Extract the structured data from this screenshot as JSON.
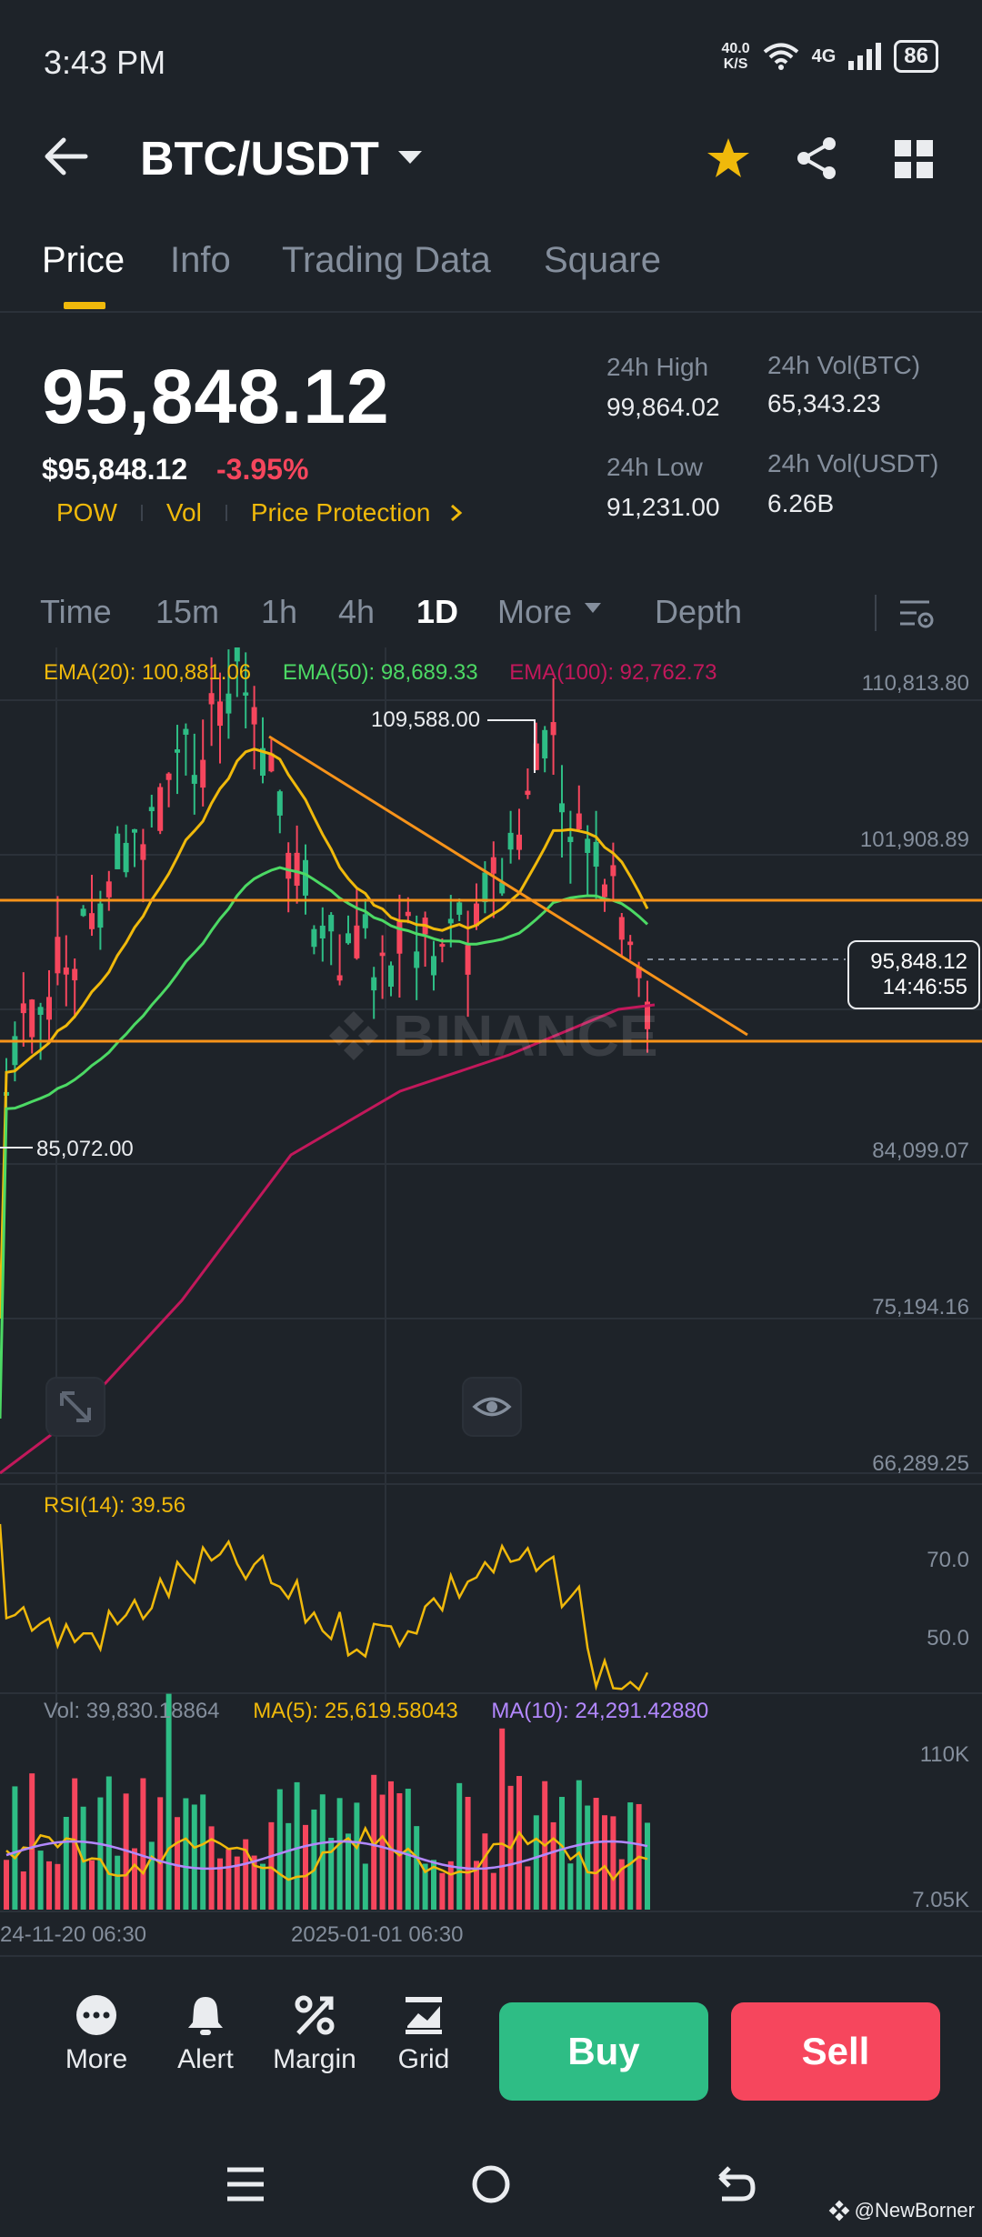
{
  "status": {
    "time": "3:43 PM",
    "net_speed_value": "40.0",
    "net_speed_unit": "K/S",
    "network": "4G",
    "battery": "86"
  },
  "header": {
    "pair": "BTC/USDT"
  },
  "tabs": [
    {
      "label": "Price"
    },
    {
      "label": "Info"
    },
    {
      "label": "Trading Data"
    },
    {
      "label": "Square"
    }
  ],
  "ticker": {
    "last_price": "95,848.12",
    "last_price_usd": "$95,848.12",
    "change_pct": "-3.95%",
    "tags": [
      "POW",
      "Vol",
      "Price Protection"
    ],
    "high_label": "24h High",
    "high_value": "99,864.02",
    "low_label": "24h Low",
    "low_value": "91,231.00",
    "vol_btc_label": "24h Vol(BTC)",
    "vol_btc_value": "65,343.23",
    "vol_usdt_label": "24h Vol(USDT)",
    "vol_usdt_value": "6.26B"
  },
  "timeframes": {
    "items": [
      "Time",
      "15m",
      "1h",
      "4h",
      "1D"
    ],
    "more": "More",
    "depth": "Depth",
    "active": "1D"
  },
  "chart": {
    "ema20": "EMA(20): 100,881.06",
    "ema50": "EMA(50): 98,689.33",
    "ema100": "EMA(100): 92,762.73",
    "price_axis": [
      "110,813.80",
      "101,908.89",
      "84,099.07",
      "75,194.16",
      "66,289.25"
    ],
    "high_marker": "109,588.00",
    "low_marker": "85,072.00",
    "current_price_tag": "95,848.12",
    "countdown": "14:46:55",
    "watermark": "BINANCE",
    "rsi_label": "RSI(14): 39.56",
    "rsi_axis": [
      "70.0",
      "50.0"
    ],
    "vol_label": "Vol: 39,830.18864",
    "ma5_label": "MA(5): 25,619.58043",
    "ma10_label": "MA(10): 24,291.42880",
    "vol_axis": [
      "110K",
      "7.05K"
    ],
    "date_labels": [
      "24-11-20 06:30",
      "2025-01-01 06:30"
    ]
  },
  "colors": {
    "bg": "#1e2329",
    "up": "#2ebd85",
    "down": "#f6465d",
    "ema20": "#f0b90b",
    "ema50": "#4cd964",
    "ema100": "#c2185b",
    "trend": "#f7931a"
  },
  "bottom_bar": {
    "items": [
      {
        "label": "More",
        "icon": "more-icon"
      },
      {
        "label": "Alert",
        "icon": "bell-icon"
      },
      {
        "label": "Margin",
        "icon": "margin-icon"
      },
      {
        "label": "Grid",
        "icon": "grid-trading-icon"
      }
    ],
    "buy": "Buy",
    "sell": "Sell"
  },
  "watermark_credit": "@NewBorner"
}
